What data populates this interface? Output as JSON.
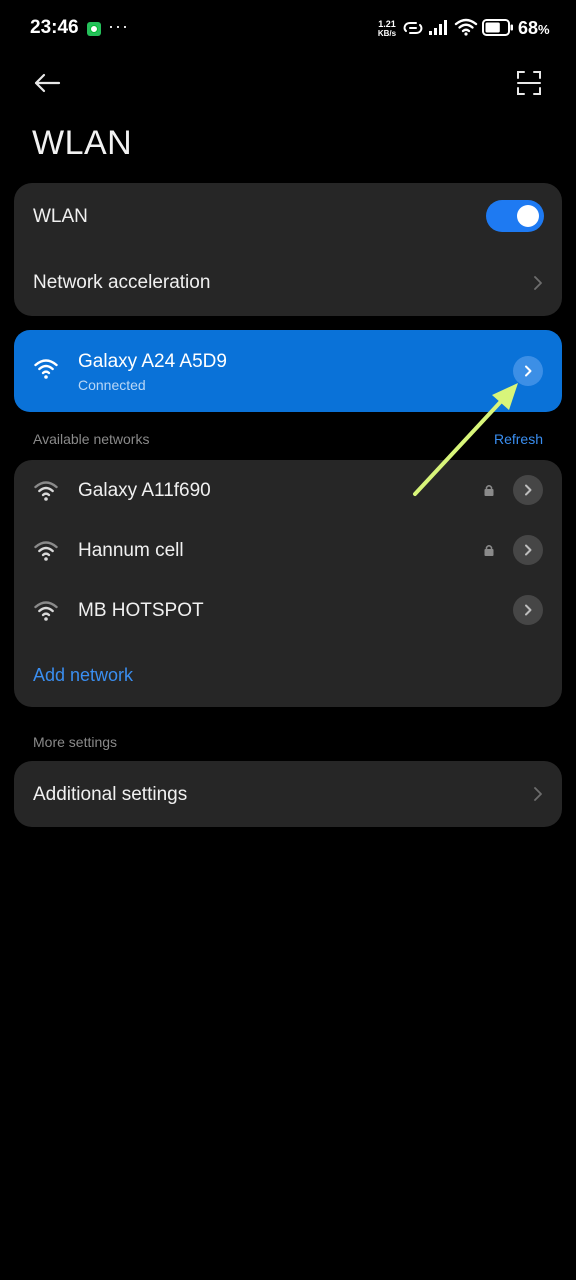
{
  "status_bar": {
    "time": "23:46",
    "more_dots": "···",
    "net_speed_value": "1.21",
    "net_speed_unit": "KB/s",
    "battery_percent": "68",
    "battery_symbol": "%",
    "battery_level": 0.68
  },
  "header": {
    "title": "WLAN"
  },
  "wlan_card": {
    "toggle_label": "WLAN",
    "toggle_on": true,
    "acceleration_label": "Network acceleration"
  },
  "connected": {
    "name": "Galaxy A24 A5D9",
    "status": "Connected"
  },
  "available": {
    "label": "Available networks",
    "refresh_label": "Refresh",
    "networks": [
      {
        "name": "Galaxy A11f690",
        "secured": true
      },
      {
        "name": "Hannum cell",
        "secured": true
      },
      {
        "name": "MB HOTSPOT",
        "secured": false
      }
    ],
    "add_network_label": "Add network"
  },
  "more": {
    "label": "More settings",
    "additional_label": "Additional settings"
  },
  "colors": {
    "accent_blue": "#0a72d8",
    "link_blue": "#3a8ef0",
    "toggle_blue": "#1e7af2",
    "card_bg": "#262626",
    "annotation_arrow": "#d8f57a"
  }
}
